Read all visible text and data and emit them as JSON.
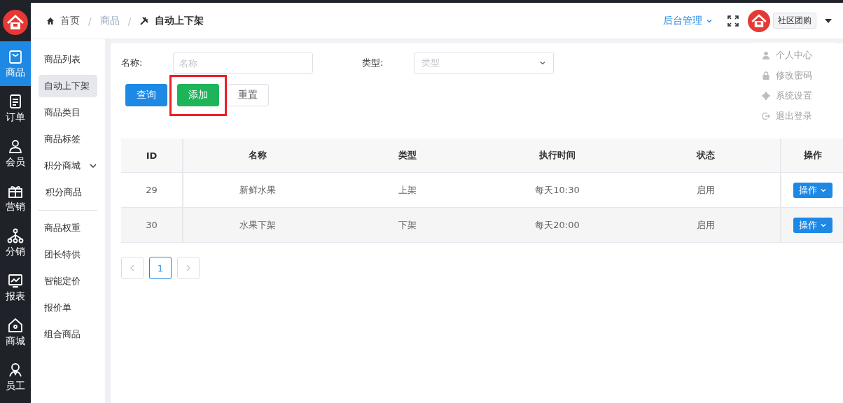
{
  "breadcrumb": [
    {
      "label": "首页",
      "kind": "home"
    },
    {
      "label": "商品",
      "kind": "plain"
    },
    {
      "label": "自动上下架",
      "kind": "tools"
    }
  ],
  "breadcrumb_separator": "/",
  "header": {
    "menu": "后台管理",
    "shop_name": "社区团购"
  },
  "user_menu": {
    "faded": true,
    "items": [
      {
        "label": "个人中心",
        "kind": "user"
      },
      {
        "label": "修改密码",
        "kind": "lock"
      },
      {
        "label": "系统设置",
        "kind": "gear"
      },
      {
        "label": "退出登录",
        "kind": "logout"
      }
    ]
  },
  "nav": [
    {
      "label": "商品",
      "kind": "bag",
      "selected": true
    },
    {
      "label": "订单",
      "kind": "doc",
      "selected": false
    },
    {
      "label": "会员",
      "kind": "person",
      "selected": false
    },
    {
      "label": "营销",
      "kind": "gift",
      "selected": false
    },
    {
      "label": "分销",
      "kind": "tree",
      "selected": false
    },
    {
      "label": "报表",
      "kind": "chart",
      "selected": false
    },
    {
      "label": "商城",
      "kind": "home",
      "selected": false
    },
    {
      "label": "员工",
      "kind": "staff",
      "selected": false
    }
  ],
  "submenu": [
    {
      "label": "商品列表",
      "selected": false
    },
    {
      "label": "自动上下架",
      "selected": true
    },
    {
      "label": "商品类目",
      "selected": false
    },
    {
      "label": "商品标签",
      "selected": false
    },
    {
      "label": "积分商城",
      "selected": false,
      "expanded": true,
      "children": [
        {
          "label": "积分商品",
          "selected": false
        }
      ]
    },
    {
      "label": "商品权重",
      "selected": false
    },
    {
      "label": "团长特供",
      "selected": false
    },
    {
      "label": "智能定价",
      "selected": false
    },
    {
      "label": "报价单",
      "selected": false
    },
    {
      "label": "组合商品",
      "selected": false
    }
  ],
  "filters": [
    {
      "label": "名称:",
      "placeholder": "名称",
      "kind": "text"
    },
    {
      "label": "类型:",
      "placeholder": "类型",
      "kind": "select"
    }
  ],
  "buttons": [
    {
      "label": "查询",
      "kind": "primary",
      "highlighted": false
    },
    {
      "label": "添加",
      "kind": "success",
      "highlighted": true
    },
    {
      "label": "重置",
      "kind": "default",
      "highlighted": false
    }
  ],
  "table": {
    "columns": [
      "ID",
      "名称",
      "类型",
      "执行时间",
      "状态",
      "操作"
    ],
    "rows": [
      {
        "cells": [
          "29",
          "新鲜水果",
          "上架",
          "每天10:30",
          "启用"
        ],
        "action": "操作"
      },
      {
        "cells": [
          "30",
          "水果下架",
          "下架",
          "每天20:00",
          "启用"
        ],
        "action": "操作"
      }
    ]
  },
  "pagination": {
    "pages": [
      {
        "label": "1",
        "selected": true
      }
    ]
  }
}
